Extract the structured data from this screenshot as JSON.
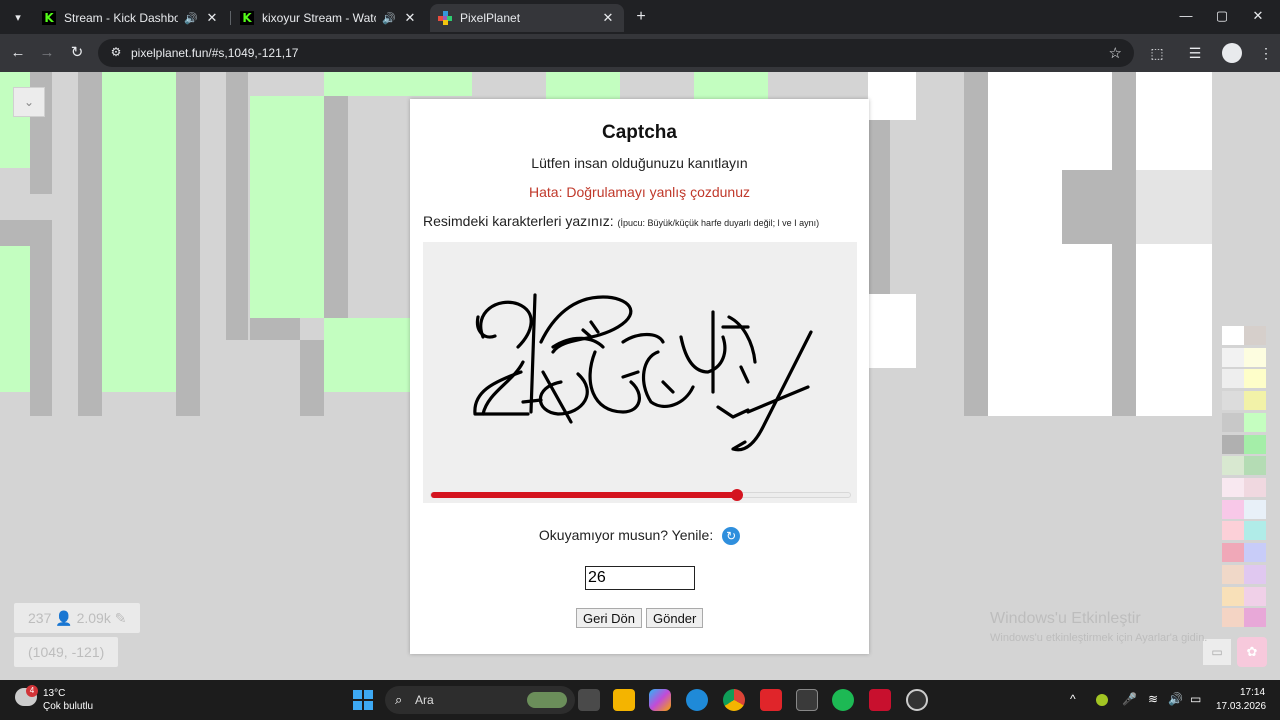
{
  "browser": {
    "tabs": [
      {
        "title": "Stream - Kick Dashboard",
        "favicon": "kick-icon"
      },
      {
        "title": "kixoyur Stream - Watch Live",
        "favicon": "kick-icon"
      },
      {
        "title": "PixelPlanet",
        "favicon": "pixelplanet-icon",
        "active": true
      }
    ],
    "url": "pixelplanet.fun/#s,1049,-121,17",
    "kick_favicon_letter": "K",
    "icons": {
      "tab_list": "▾",
      "audio": "🔊",
      "close": "✕",
      "new_tab": "+",
      "back": "←",
      "forward": "→",
      "reload": "↻",
      "site_info": "⚙",
      "star": "☆",
      "extensions": "⬚",
      "media": "☰",
      "minimize": "—",
      "maximize": "▢",
      "win_close": "✕"
    }
  },
  "canvas": {
    "corner_button": "⌄",
    "stats": "237 👤 2.09k ✎",
    "coords": "(1049, -121)",
    "chat_icon": "▭",
    "fav_icon": "✿",
    "palette_colors": [
      "#ffffff",
      "#d6cfcb",
      "#f2f2f2",
      "#fdfde0",
      "#eeeeee",
      "#fefec9",
      "#dcdcdc",
      "#f2f2a8",
      "#c8c8c8",
      "#c5fec0",
      "#b0b0b0",
      "#a4eea8",
      "#d8e8d0",
      "#b4dcb4",
      "#f8e8f0",
      "#f0d8e0",
      "#f8c8e8",
      "#e8f0f8",
      "#fcd0d8",
      "#b0ece8",
      "#f0a8b8",
      "#c8ccf8",
      "#f0d8c8",
      "#e0c8f0",
      "#f8e0b8",
      "#f0d0e8",
      "#f4d4c4",
      "#e8a8d8"
    ]
  },
  "captcha": {
    "title": "Captcha",
    "subtitle": "Lütfen insan olduğunuzu kanıtlayın",
    "error": "Hata: Doğrulamayı yanlış çozdunuz",
    "instruction": "Resimdeki karakterleri yazınız:",
    "hint": "(İpucu: Büyük/küçük harfe duyarlı değil; l ve I aynı)",
    "slider_value": 0.73,
    "reload_text": "Okuyamıyor musun? Yenile:",
    "reload_icon": "↻",
    "input_value": "26",
    "back_label": "Geri Dön",
    "submit_label": "Gönder"
  },
  "watermark": {
    "line1": "Windows'u Etkinleştir",
    "line2": "Windows'u etkinleştirmek için Ayarlar'a gidin."
  },
  "taskbar": {
    "weather_temp": "13°C",
    "weather_desc": "Çok bulutlu",
    "weather_badge": "4",
    "search_placeholder": "Ara",
    "search_icon": "⌕",
    "tray_icons": {
      "chevron": "^",
      "mic": "🎤",
      "wifi": "≋",
      "volume": "🔊",
      "battery": "▭"
    },
    "time": "17:14",
    "date": "17.03.2026"
  }
}
